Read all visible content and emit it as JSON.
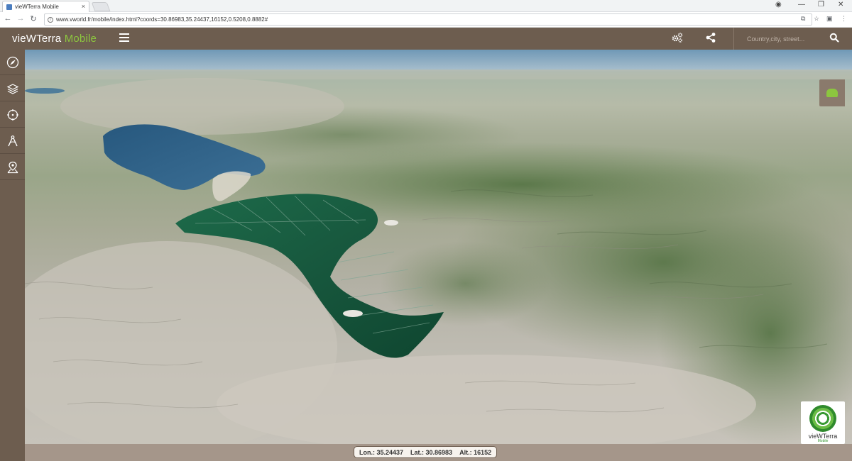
{
  "browser": {
    "tab_title": "vieWTerra Mobile",
    "tab_close": "×",
    "url": "www.vworld.fr/mobile/index.html?coords=30.86983,35.24437,16152,0.5208,0.8882#",
    "window_minimize": "—",
    "window_restore": "❐",
    "window_close": "✕"
  },
  "header": {
    "brand_main": "vieWTerra",
    "brand_accent": "Mobile",
    "search_placeholder": "Country,city, street...",
    "colors": {
      "bar": "#6d5d4f",
      "accent": "#8cc63f"
    }
  },
  "toolbar": {
    "items": [
      {
        "icon": "compass-icon"
      },
      {
        "icon": "layers-icon"
      },
      {
        "icon": "crosshair-icon"
      },
      {
        "icon": "measure-icon"
      },
      {
        "icon": "place-marker-icon"
      }
    ]
  },
  "logo": {
    "name": "vieWTerra",
    "sub": "Mobile"
  },
  "status": {
    "lon": "Lon.: 35.24437",
    "lat": "Lat.: 30.86983",
    "alt": "Alt.: 16152"
  }
}
